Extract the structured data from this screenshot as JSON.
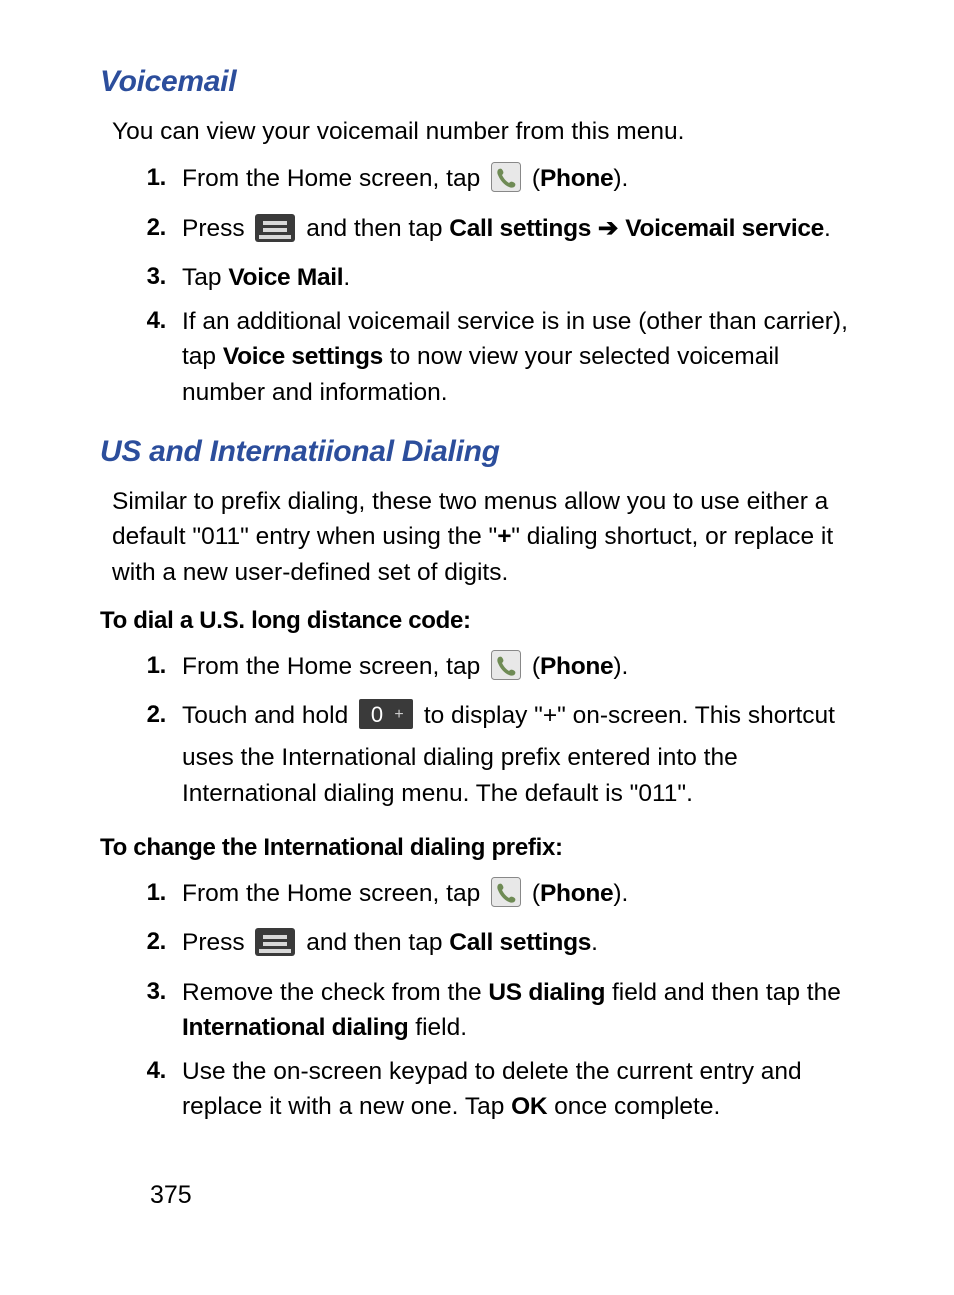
{
  "section1": {
    "heading": "Voicemail",
    "intro": "You can view your voicemail number from this menu.",
    "step1_a": "From the Home screen, tap ",
    "step1_b": " (",
    "step1_phone": "Phone",
    "step1_c": ").",
    "step2_a": "Press ",
    "step2_b": " and then tap ",
    "step2_call": "Call settings",
    "step2_arrow": " ➔ ",
    "step2_vm": "Voicemail service",
    "step2_c": ".",
    "step3_a": "Tap ",
    "step3_vm": "Voice Mail",
    "step3_b": ".",
    "step4_a": "If an additional voicemail service is in use (other than carrier), tap ",
    "step4_vs": "Voice settings",
    "step4_b": " to now view your selected voicemail number and information."
  },
  "section2": {
    "heading": "US and Internatiional Dialing",
    "intro_a": "Similar to prefix dialing, these two menus allow you to use either a default \"011\" entry when using the \"",
    "intro_plus": "+",
    "intro_b": "\" dialing shortuct, or replace it with a new user-defined set of digits.",
    "sub1": "To dial a U.S. long distance code:",
    "s1_step1_a": "From the Home screen, tap ",
    "s1_step1_b": " (",
    "s1_step1_phone": "Phone",
    "s1_step1_c": ").",
    "s1_step2_a": "Touch and hold ",
    "s1_step2_b": " to display \"+\" on-screen. This shortcut uses the International dialing prefix entered into the International dialing menu. The default is \"011\".",
    "sub2": "To change the International dialing prefix:",
    "s2_step1_a": "From the Home screen, tap ",
    "s2_step1_b": " (",
    "s2_step1_phone": "Phone",
    "s2_step1_c": ").",
    "s2_step2_a": "Press ",
    "s2_step2_b": " and then tap ",
    "s2_step2_call": "Call settings",
    "s2_step2_c": ".",
    "s2_step3_a": "Remove the check from the ",
    "s2_step3_us": "US dialing",
    "s2_step3_b": " field and then tap the ",
    "s2_step3_intl": "International dialing",
    "s2_step3_c": " field.",
    "s2_step4_a": "Use the on-screen keypad to delete the current entry and replace it with a new one. Tap ",
    "s2_step4_ok": "OK",
    "s2_step4_b": " once complete."
  },
  "page_number": "375"
}
